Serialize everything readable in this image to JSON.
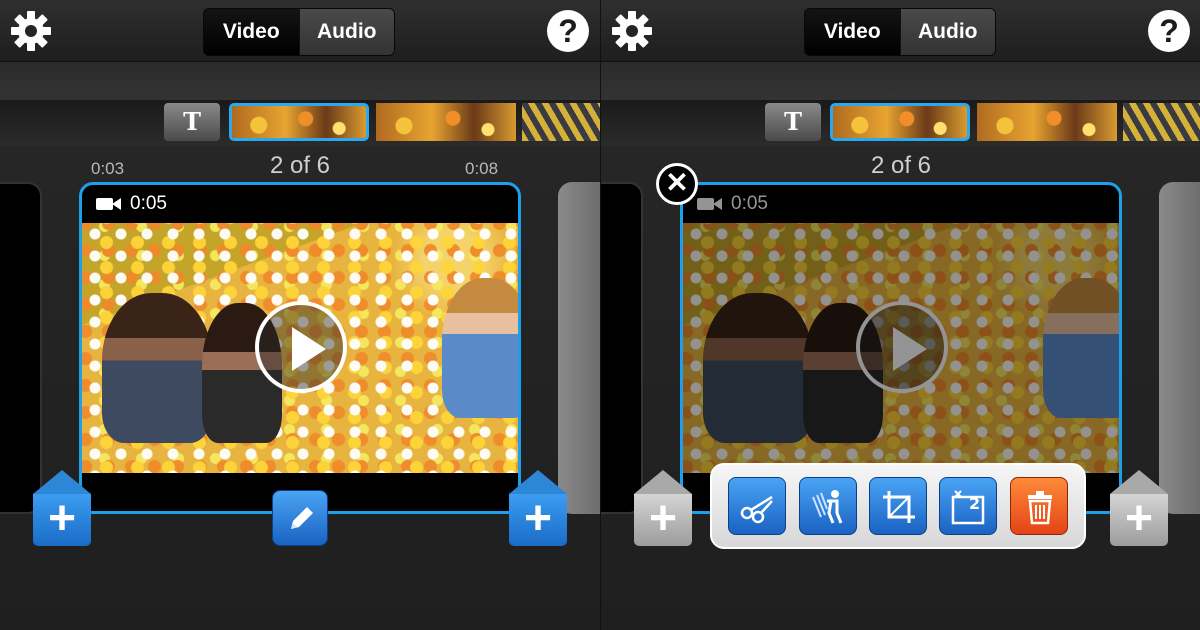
{
  "left": {
    "tabs": [
      {
        "label": "Video",
        "active": true
      },
      {
        "label": "Audio",
        "active": false
      }
    ],
    "title_tile": "T",
    "timecode_start": "0:03",
    "timecode_end": "0:08",
    "counter": "2 of 6",
    "clip_duration": "0:05"
  },
  "right": {
    "tabs": [
      {
        "label": "Video",
        "active": true
      },
      {
        "label": "Audio",
        "active": false
      }
    ],
    "title_tile": "T",
    "counter": "2 of 6",
    "clip_duration": "0:05",
    "tools": [
      "scissors-icon",
      "speed-icon",
      "crop-icon",
      "zoom-icon",
      "trash-icon"
    ]
  },
  "icons": {
    "settings": "gear-icon",
    "help": "?",
    "add": "+",
    "close": "✕"
  },
  "colors": {
    "accent": "#1ca0ec",
    "button_blue": "#2e86d6",
    "delete": "#e34416"
  }
}
